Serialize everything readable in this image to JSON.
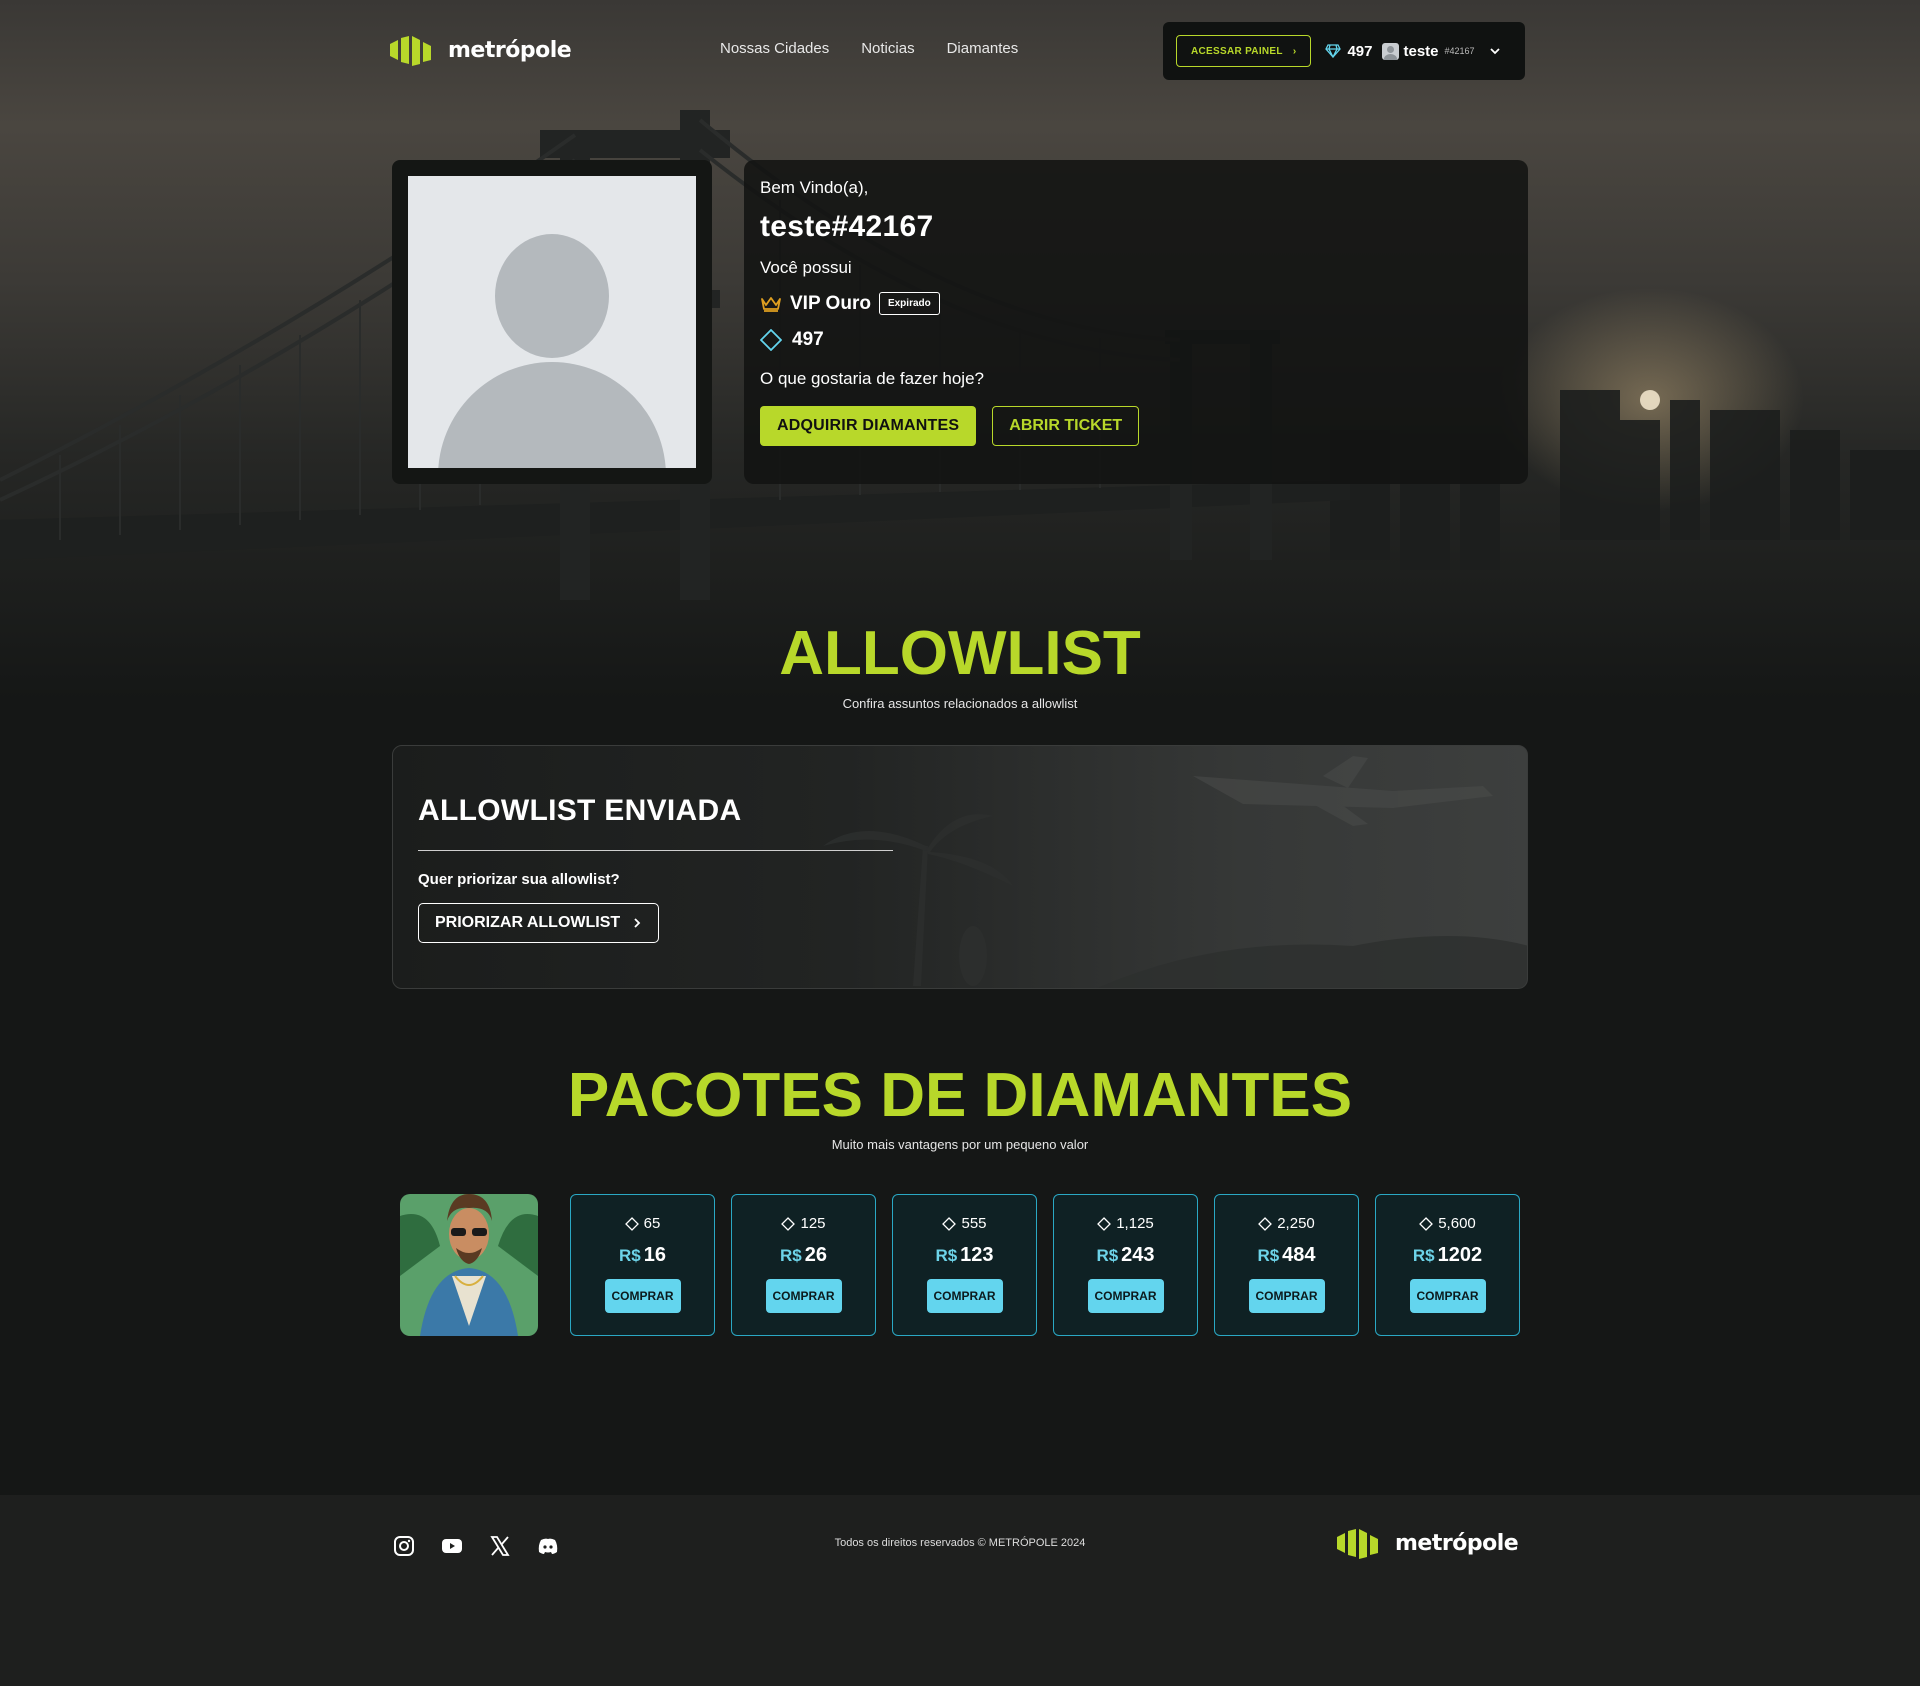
{
  "colors": {
    "accent": "#b8d82a",
    "cyan": "#63d5ee",
    "bg": "#151716"
  },
  "nav": {
    "brand": "metrópole",
    "links": [
      "Nossas Cidades",
      "Noticias",
      "Diamantes"
    ],
    "panel_button": "ACESSAR PAINEL",
    "diamonds": "497",
    "username": "teste",
    "user_tag": "#42167"
  },
  "profile": {
    "greeting": "Bem Vindo(a),",
    "name": "teste#42167",
    "you_have": "Você possui",
    "vip_label": "VIP Ouro",
    "vip_status": "Expirado",
    "diamonds": "497",
    "question": "O que gostaria de fazer hoje?",
    "buy_button": "ADQUIRIR DIAMANTES",
    "ticket_button": "ABRIR TICKET"
  },
  "allowlist": {
    "title": "ALLOWLIST",
    "subtitle": "Confira assuntos relacionados a allowlist",
    "card_title": "ALLOWLIST ENVIADA",
    "question": "Quer priorizar sua allowlist?",
    "button": "PRIORIZAR ALLOWLIST"
  },
  "packages": {
    "title": "PACOTES DE DIAMANTES",
    "subtitle": "Muito mais vantagens por um pequeno valor",
    "currency": "R$",
    "buy_label": "COMPRAR",
    "items": [
      {
        "amount": "65",
        "price": "16"
      },
      {
        "amount": "125",
        "price": "26"
      },
      {
        "amount": "555",
        "price": "123"
      },
      {
        "amount": "1,125",
        "price": "243"
      },
      {
        "amount": "2,250",
        "price": "484"
      },
      {
        "amount": "5,600",
        "price": "1202"
      }
    ]
  },
  "footer": {
    "copyright": "Todos os direitos reservados © METRÓPOLE 2024",
    "social": [
      "instagram-icon",
      "youtube-icon",
      "x-icon",
      "discord-icon"
    ],
    "brand": "metrópole"
  }
}
